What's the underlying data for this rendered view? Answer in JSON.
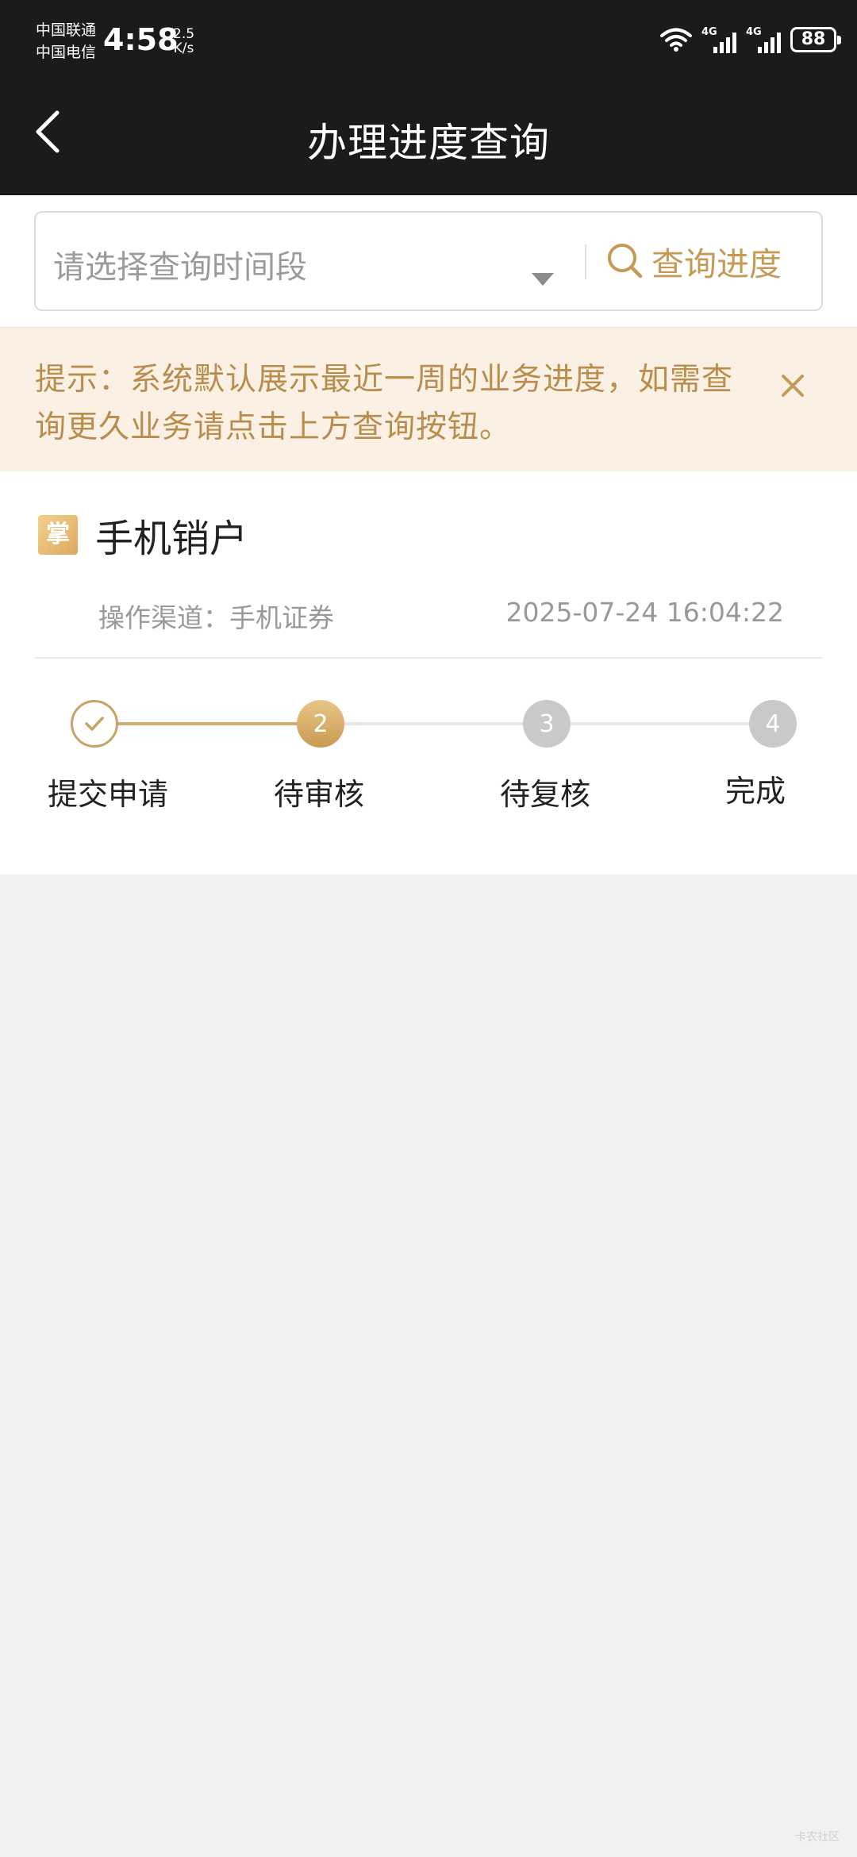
{
  "status_bar": {
    "carrier1": "中国联通",
    "carrier2": "中国电信",
    "time": "4:58",
    "speed_value": "2.5",
    "speed_unit": "K/s",
    "net1": "4G",
    "net2": "4G",
    "battery": "88"
  },
  "nav": {
    "title": "办理进度查询"
  },
  "search": {
    "placeholder": "请选择查询时间段",
    "button_label": "查询进度"
  },
  "tip": {
    "text": "提示：系统默认展示最近一周的业务进度，如需查询更久业务请点击上方查询按钮。"
  },
  "record": {
    "badge": "掌",
    "title": "手机销户",
    "channel": "操作渠道：手机证券",
    "datetime": "2025-07-24 16:04:22"
  },
  "steps": [
    {
      "label": "提交申请",
      "number": "",
      "state": "done"
    },
    {
      "label": "待审核",
      "number": "2",
      "state": "current"
    },
    {
      "label": "待复核",
      "number": "3",
      "state": "pending"
    },
    {
      "label": "完成",
      "number": "4",
      "state": "pending"
    }
  ],
  "watermark": "卡农社区",
  "colors": {
    "accent": "#c49a55",
    "tip_bg": "#faf0e4",
    "topbar": "#1b1b1d",
    "pending": "#c9c9c9"
  }
}
